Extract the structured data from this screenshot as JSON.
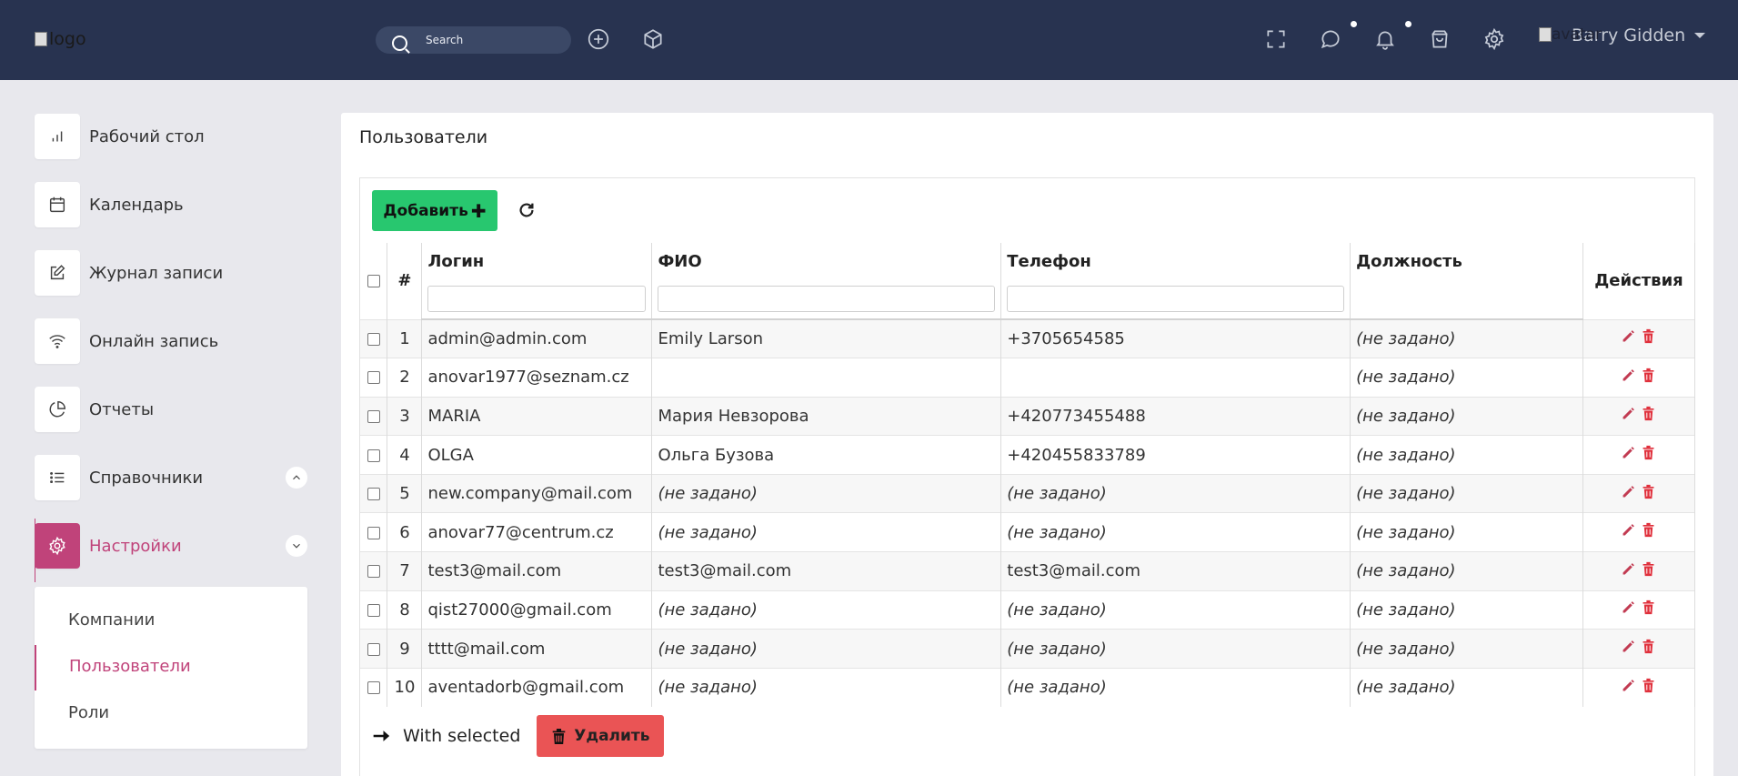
{
  "header": {
    "logo_alt": "logo",
    "search_placeholder": "Search",
    "avatar_alt": "avatar",
    "user_name": "Barry Gidden"
  },
  "sidebar": {
    "items": [
      {
        "label": "Рабочий стол",
        "icon": "bar-chart-icon"
      },
      {
        "label": "Календарь",
        "icon": "calendar-icon"
      },
      {
        "label": "Журнал записи",
        "icon": "edit-icon"
      },
      {
        "label": "Онлайн запись",
        "icon": "wifi-icon"
      },
      {
        "label": "Отчеты",
        "icon": "pie-chart-icon"
      },
      {
        "label": "Справочники",
        "icon": "list-icon"
      },
      {
        "label": "Настройки",
        "icon": "settings-icon"
      }
    ],
    "submenu": [
      "Компании",
      "Пользователи",
      "Роли"
    ],
    "active_color": "#c0437a"
  },
  "main": {
    "title": "Пользователи",
    "add_label": "Добавить",
    "columns": [
      "#",
      "Логин",
      "ФИО",
      "Телефон",
      "Должность",
      "Действия"
    ],
    "rows": [
      {
        "n": "1",
        "login": "admin@admin.com",
        "fio": "Emily Larson",
        "phone": "+3705654585",
        "position": "(не задано)"
      },
      {
        "n": "2",
        "login": "anovar1977@seznam.cz",
        "fio": "",
        "phone": "",
        "position": "(не задано)"
      },
      {
        "n": "3",
        "login": "MARIA",
        "fio": "Мария Невзорова",
        "phone": "+420773455488",
        "position": "(не задано)"
      },
      {
        "n": "4",
        "login": "OLGA",
        "fio": "Ольга Бузова",
        "phone": "+420455833789",
        "position": "(не задано)"
      },
      {
        "n": "5",
        "login": "new.company@mail.com",
        "fio": "(не задано)",
        "phone": "(не задано)",
        "position": "(не задано)"
      },
      {
        "n": "6",
        "login": "anovar77@centrum.cz",
        "fio": "(не задано)",
        "phone": "(не задано)",
        "position": "(не задано)"
      },
      {
        "n": "7",
        "login": "test3@mail.com",
        "fio": "test3@mail.com",
        "phone": "test3@mail.com",
        "position": "(не задано)"
      },
      {
        "n": "8",
        "login": "qist27000@gmail.com",
        "fio": "(не задано)",
        "phone": "(не задано)",
        "position": "(не задано)"
      },
      {
        "n": "9",
        "login": "tttt@mail.com",
        "fio": "(не задано)",
        "phone": "(не задано)",
        "position": "(не задано)"
      },
      {
        "n": "10",
        "login": "aventadorb@gmail.com",
        "fio": "(не задано)",
        "phone": "(не задано)",
        "position": "(не задано)"
      }
    ],
    "with_selected": "With selected",
    "delete_label": "Удалить",
    "colors": {
      "add": "#28c76f",
      "delete": "#ea5455",
      "not_set": "#d0494f",
      "header_bg": "#283350"
    }
  }
}
